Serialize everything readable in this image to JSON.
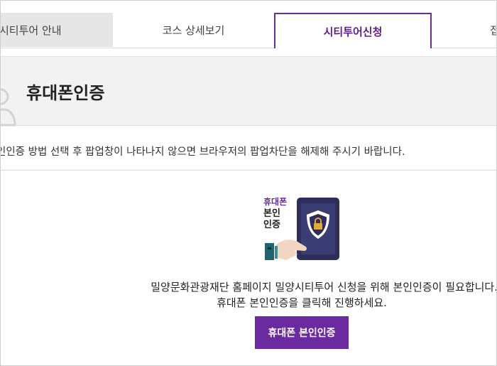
{
  "tabs": [
    {
      "label": "시티투어 안내"
    },
    {
      "label": "코스 상세보기"
    },
    {
      "label": "시티투어신청"
    },
    {
      "label": "접"
    }
  ],
  "header": {
    "title": "휴대폰인증"
  },
  "notice": "인인증 방법 선택 후 팝업창이 나타나지 않으면 브라우저의 팝업차단을 해제해 주시기 바랍니다.",
  "illustration": {
    "line1": "휴대폰",
    "line2": "본인",
    "line3": "인증",
    "icon": "phone-shield-lock-icon"
  },
  "message": {
    "line1": "밀양문화관광재단 홈페이지 밀양시티투어 신청을 위해 본인인증이 필요합니다.",
    "line2": "휴대폰 본인인증을 클릭해 진행하세요."
  },
  "button": {
    "label": "휴대폰 본인인증"
  },
  "colors": {
    "accent": "#6b2aa0",
    "phone": "#2d2e5c",
    "tab_active": "#5a1f84"
  }
}
